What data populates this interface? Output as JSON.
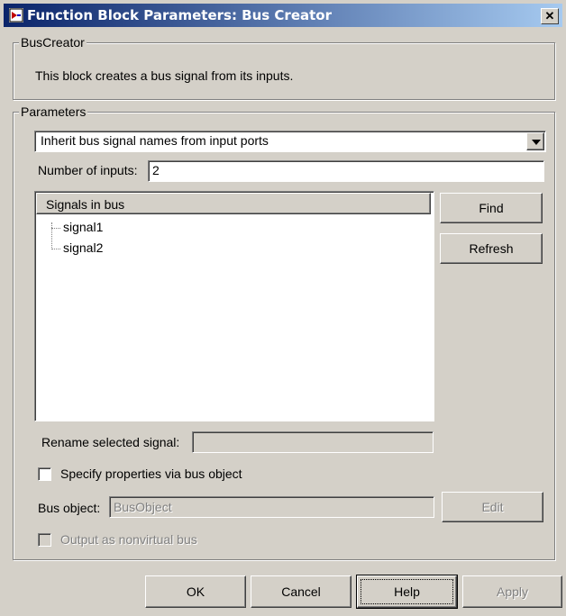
{
  "window": {
    "title": "Function Block Parameters: Bus Creator",
    "close_glyph": "✕"
  },
  "block_group": {
    "legend": "BusCreator",
    "description": "This block creates a bus signal from its inputs."
  },
  "params_group": {
    "legend": "Parameters"
  },
  "inherit_dropdown": {
    "value": "Inherit bus signal names from input ports"
  },
  "num_inputs": {
    "label": "Number of inputs:",
    "value": "2"
  },
  "signals": {
    "header": "Signals in bus",
    "items": [
      "signal1",
      "signal2"
    ]
  },
  "find_button": "Find",
  "refresh_button": "Refresh",
  "rename": {
    "label": "Rename selected signal:",
    "value": ""
  },
  "specify_checkbox": {
    "label": "Specify properties via bus object",
    "checked": false
  },
  "bus_object": {
    "label": "Bus object:",
    "value": "BusObject"
  },
  "edit_button": "Edit",
  "output_checkbox": {
    "label": "Output as nonvirtual bus",
    "checked": false
  },
  "footer": {
    "ok": "OK",
    "cancel": "Cancel",
    "help": "Help",
    "apply": "Apply"
  }
}
